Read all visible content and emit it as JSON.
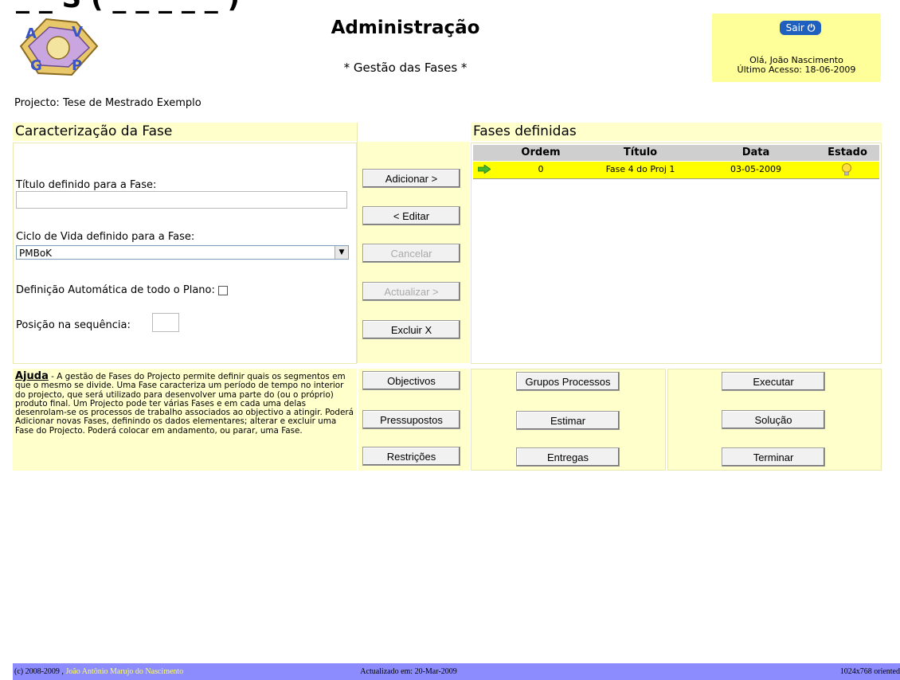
{
  "header": {
    "cutoff_text": "_ _ S ( _ _ _ _ _ )",
    "title": "Administração",
    "subtitle": "* Gestão das Fases *"
  },
  "user": {
    "logout_label": "Sair",
    "greeting": "Olá, João Nascimento",
    "last_access": "Último Acesso: 18-06-2009"
  },
  "project": {
    "text": "Projecto:  Tese de Mestrado Exemplo"
  },
  "phase_form": {
    "heading": "Caracterização da Fase",
    "title_label": "Título definido para a Fase:",
    "title_value": "",
    "lifecycle_label": "Ciclo de Vida definido para a Fase:",
    "lifecycle_value": "PMBoK",
    "auto_plan_label": "Definição Automática de todo o Plano:",
    "position_label": "Posição na sequência:",
    "position_value": ""
  },
  "actions": {
    "add": "Adicionar >",
    "edit": "< Editar",
    "cancel": "Cancelar",
    "update": "Actualizar >",
    "delete": "Excluir X"
  },
  "phases": {
    "heading": "Fases definidas",
    "columns": [
      "Ordem",
      "Título",
      "Data",
      "Estado"
    ],
    "rows": [
      {
        "ordem": "0",
        "titulo": "Fase 4 do Proj 1",
        "data": "03-05-2009"
      }
    ]
  },
  "help": {
    "title": "Ajuda",
    "text": " - A gestão de Fases do Projecto permite definir quais os segmentos em que o mesmo se divide. Uma Fase caracteriza um período de tempo no interior do projecto, que será utilizado para desenvolver uma parte do (ou o próprio) produto final. Um Projecto pode ter várias Fases e em cada uma delas desenrolam-se os processos de trabalho associados ao objectivo a atingir. Poderá Adicionar novas Fases, definindo os dados elementares; alterar e excluir uma Fase do Projecto. Poderá colocar em andamento, ou parar, uma Fase."
  },
  "nav_buttons": {
    "objectivos": "Objectivos",
    "pressupostos": "Pressupostos",
    "restricoes": "Restrições",
    "grupos_processos": "Grupos Processos",
    "estimar": "Estimar",
    "entregas": "Entregas",
    "executar": "Executar",
    "solucao": "Solução",
    "terminar": "Terminar"
  },
  "footer": {
    "copyright": "(c) 2008-2009 , ",
    "author": "João Antônio Marujo do Nascimento",
    "updated": "Actualizado em: 20-Mar-2009",
    "resolution": "1024x768 oriented"
  },
  "colors": {
    "panel_yellow": "#ffffcc",
    "row_highlight": "#ffff00",
    "footer_blue": "#8c8cff",
    "logout_blue": "#1f5fbf"
  },
  "icons": [
    "logo-icon",
    "power-icon",
    "arrow-right-icon",
    "lightbulb-icon",
    "chevron-down-icon"
  ]
}
